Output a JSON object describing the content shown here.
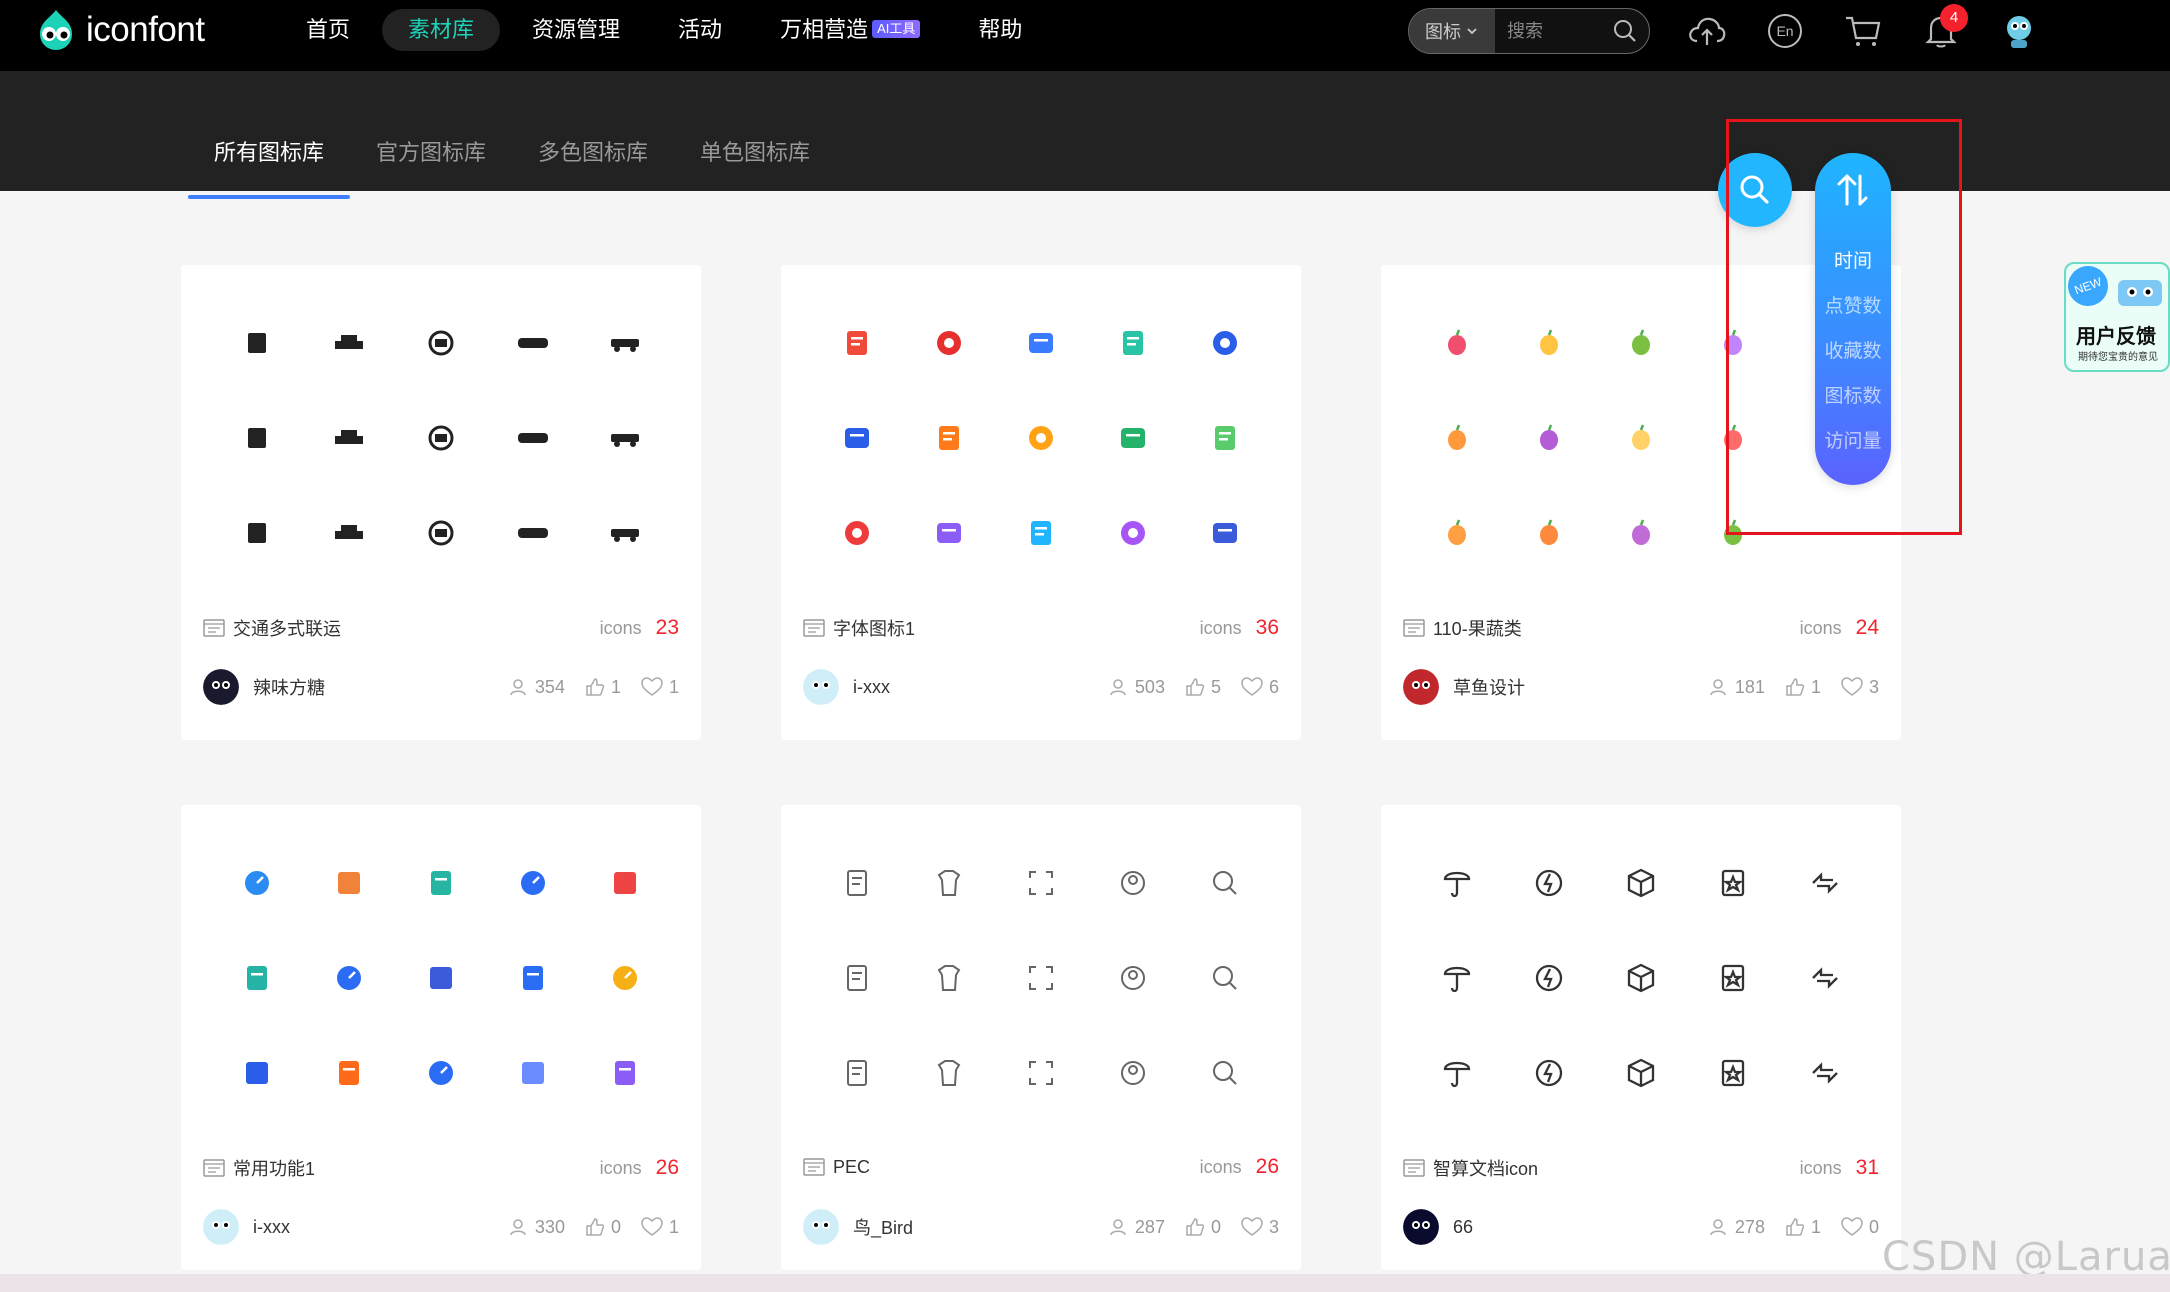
{
  "app": {
    "logo_text": "iconfont"
  },
  "nav": {
    "items": [
      {
        "label": "首页"
      },
      {
        "label": "素材库"
      },
      {
        "label": "资源管理"
      },
      {
        "label": "活动"
      },
      {
        "label": "万相营造",
        "badge": "AI工具"
      },
      {
        "label": "帮助"
      }
    ],
    "active_index": 1
  },
  "search": {
    "type_label": "图标",
    "placeholder": "搜索"
  },
  "toolbar": {
    "notification_count": "4"
  },
  "tabs": {
    "items": [
      {
        "label": "所有图标库"
      },
      {
        "label": "官方图标库"
      },
      {
        "label": "多色图标库"
      },
      {
        "label": "单色图标库"
      }
    ],
    "active_index": 0
  },
  "sort_menu": {
    "options": [
      {
        "label": "时间"
      },
      {
        "label": "点赞数"
      },
      {
        "label": "收藏数"
      },
      {
        "label": "图标数"
      },
      {
        "label": "访问量"
      }
    ],
    "active_index": 0
  },
  "feedback": {
    "badge": "NEW",
    "title": "用户反馈",
    "subtitle": "期待您宝贵的意见"
  },
  "cards": [
    {
      "title": "交通多式联运",
      "icons_label": "icons",
      "icons_count": "23",
      "author": "辣味方糖",
      "views": "354",
      "likes": "1",
      "favorites": "1",
      "style": "black"
    },
    {
      "title": "字体图标1",
      "icons_label": "icons",
      "icons_count": "36",
      "author": "i-xxx",
      "views": "503",
      "likes": "5",
      "favorites": "6",
      "style": "color"
    },
    {
      "title": "110-果蔬类",
      "icons_label": "icons",
      "icons_count": "24",
      "author": "草鱼设计",
      "views": "181",
      "likes": "1",
      "favorites": "3",
      "style": "fruit"
    },
    {
      "title": "常用功能1",
      "icons_label": "icons",
      "icons_count": "26",
      "author": "i-xxx",
      "views": "330",
      "likes": "0",
      "favorites": "1",
      "style": "color2"
    },
    {
      "title": "PEC",
      "icons_label": "icons",
      "icons_count": "26",
      "author": "鸟_Bird",
      "views": "287",
      "likes": "0",
      "favorites": "3",
      "style": "line"
    },
    {
      "title": "智算文档icon",
      "icons_label": "icons",
      "icons_count": "31",
      "author": "66",
      "views": "278",
      "likes": "1",
      "favorites": "0",
      "style": "line2"
    }
  ],
  "watermark": "CSDN @Laruae",
  "colors": {
    "accent": "#1cd3b7",
    "sort_gradient_top": "#1fb5ff",
    "sort_gradient_bottom": "#5b62ff",
    "count_red": "#f5222d",
    "highlight": "#e5141c"
  }
}
